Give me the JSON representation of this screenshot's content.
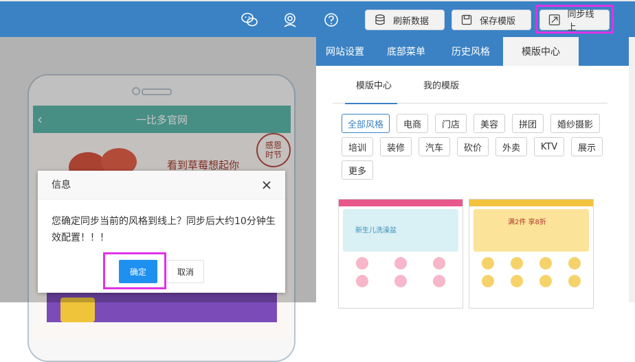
{
  "toolbar": {
    "refresh_label": "刷新数据",
    "save_template_label": "保存模版",
    "sync_label": "同步线上",
    "icons": [
      "wechat-icon",
      "support-agent-icon",
      "help-icon"
    ]
  },
  "phone": {
    "title": "一比多官网",
    "promo_text": "看到草莓想起你",
    "seal_line1": "感恩",
    "seal_line2": "时节"
  },
  "right_panel": {
    "tabs": [
      "网站设置",
      "底部菜单",
      "历史风格",
      "模版中心"
    ],
    "active_tab": "模版中心",
    "subtabs": [
      "模版中心",
      "我的模版"
    ],
    "tags": [
      "全部风格",
      "电商",
      "门店",
      "美容",
      "拼团",
      "婚纱摄影",
      "培训",
      "装修",
      "汽车",
      "砍价",
      "外卖",
      "KTV",
      "展示",
      "更多"
    ],
    "active_tag": "全部风格",
    "thumbnails": [
      {
        "banner_text": "新生儿洗澡盆",
        "accent": "#e8588a"
      },
      {
        "banner_text": "满2件 享8折",
        "accent": "#f3c23e"
      }
    ]
  },
  "dialog": {
    "title": "信息",
    "message": "您确定同步当前的风格到线上？同步后大约10分钟生效配置！！！",
    "ok_label": "确定",
    "cancel_label": "取消"
  },
  "colors": {
    "primary": "#3a82c4",
    "highlight": "#e032e6",
    "ok_button": "#1e90f0"
  }
}
